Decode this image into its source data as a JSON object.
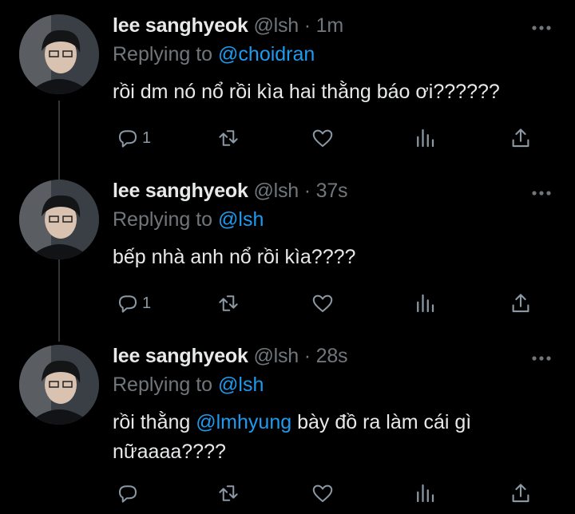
{
  "tweets": [
    {
      "display_name": "lee sanghyeok",
      "handle": "@lsh",
      "separator": "·",
      "time": "1m",
      "replying_prefix": "Replying to",
      "replying_to": "@choidran",
      "text": "rồi dm nó nổ rồi kìa hai thằng báo ơi??????",
      "reply_count": "1"
    },
    {
      "display_name": "lee sanghyeok",
      "handle": "@lsh",
      "separator": "·",
      "time": "37s",
      "replying_prefix": "Replying to",
      "replying_to": "@lsh",
      "text": "bếp nhà anh nổ rồi kìa????",
      "reply_count": "1"
    },
    {
      "display_name": "lee sanghyeok",
      "handle": "@lsh",
      "separator": "·",
      "time": "28s",
      "replying_prefix": "Replying to",
      "replying_to": "@lsh",
      "text_before": "rồi thằng",
      "text_mention": "@lmhyung",
      "text_after": "bày đồ ra làm cái gì",
      "text_line2": "nữaaaa????"
    }
  ],
  "icons": [
    "reply-icon",
    "retweet-icon",
    "like-icon",
    "analytics-icon",
    "share-icon",
    "more-icon"
  ],
  "colors": {
    "background": "#000000",
    "text": "#e7e9ea",
    "muted": "#71767b",
    "accent": "#1d9bf0"
  }
}
